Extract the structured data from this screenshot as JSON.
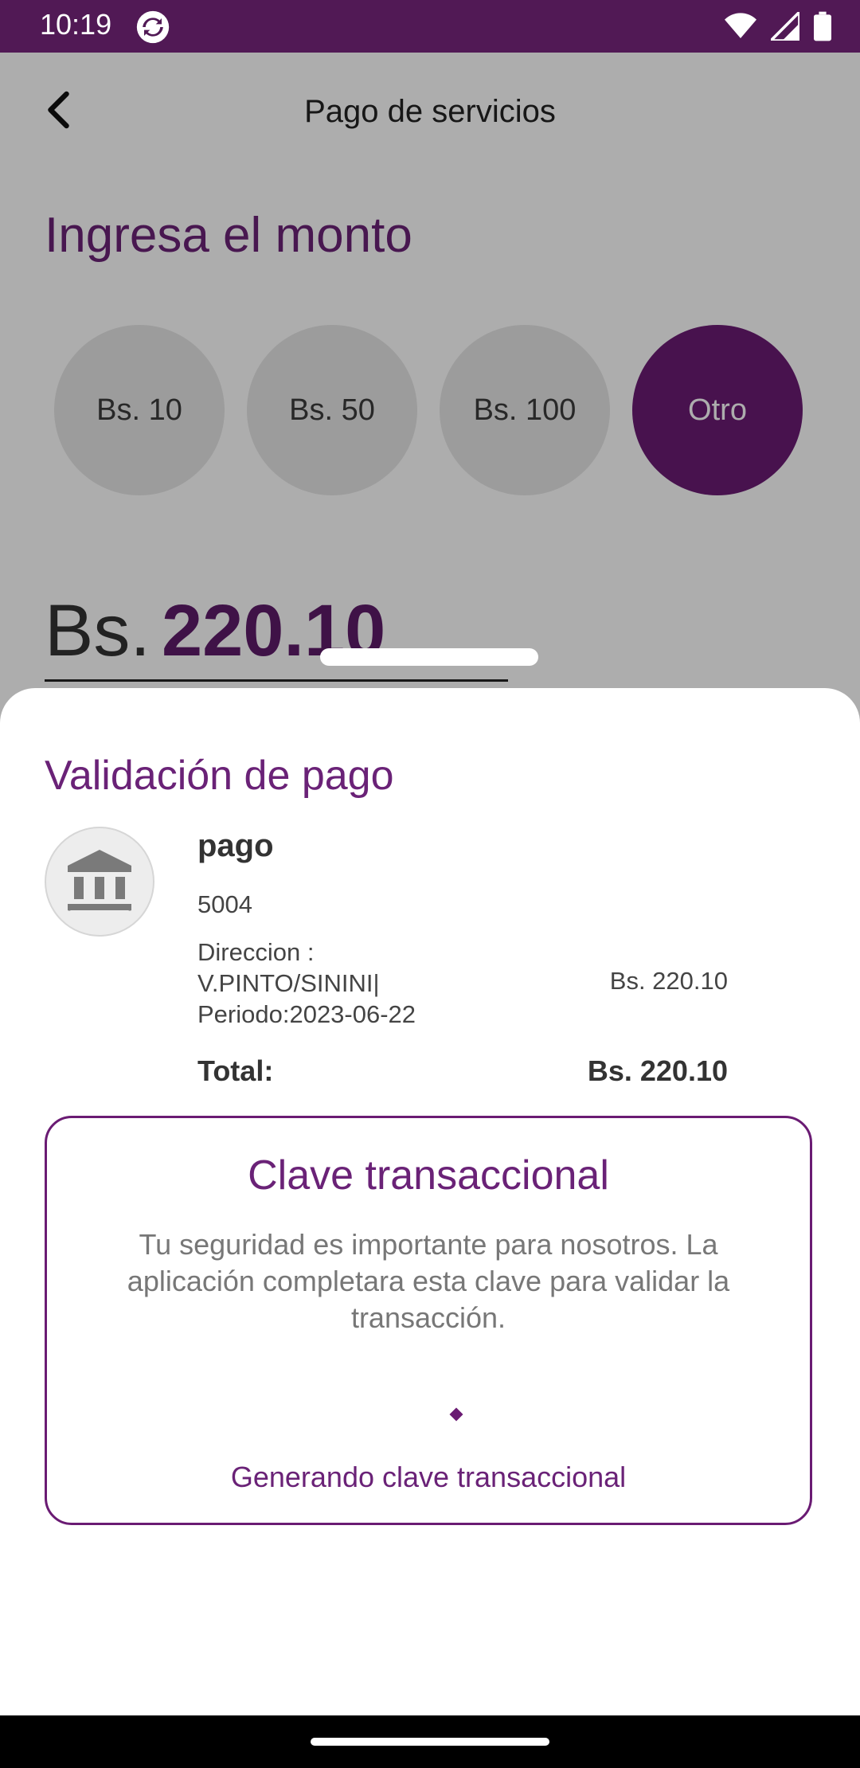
{
  "status_bar": {
    "time": "10:19"
  },
  "app_bar": {
    "title": "Pago de servicios"
  },
  "content": {
    "heading": "Ingresa el monto",
    "amount_options": [
      "Bs. 10",
      "Bs. 50",
      "Bs. 100",
      "Otro"
    ],
    "selected_option": "Otro",
    "currency": "Bs.",
    "amount": "220.10"
  },
  "sheet": {
    "title": "Validación de pago",
    "service_name": "pago",
    "service_code": "5004",
    "detail_lines": [
      "Direccion :",
      "V.PINTO/SININI|",
      "Periodo:2023-06-22"
    ],
    "detail_amount": "Bs. 220.10",
    "total_label": "Total:",
    "total_value": "Bs. 220.10",
    "key_card": {
      "title": "Clave transaccional",
      "description": "Tu seguridad es importante para nosotros. La aplicación completara esta clave para validar la transacción.",
      "status": "Generando clave transaccional"
    }
  },
  "colors": {
    "brand": "#6a1b73",
    "status_bar": "#511955",
    "heading": "#6a2277"
  },
  "icons": [
    "sync-icon",
    "wifi-icon",
    "signal-icon",
    "battery-icon",
    "back-arrow-icon",
    "bank-icon"
  ]
}
